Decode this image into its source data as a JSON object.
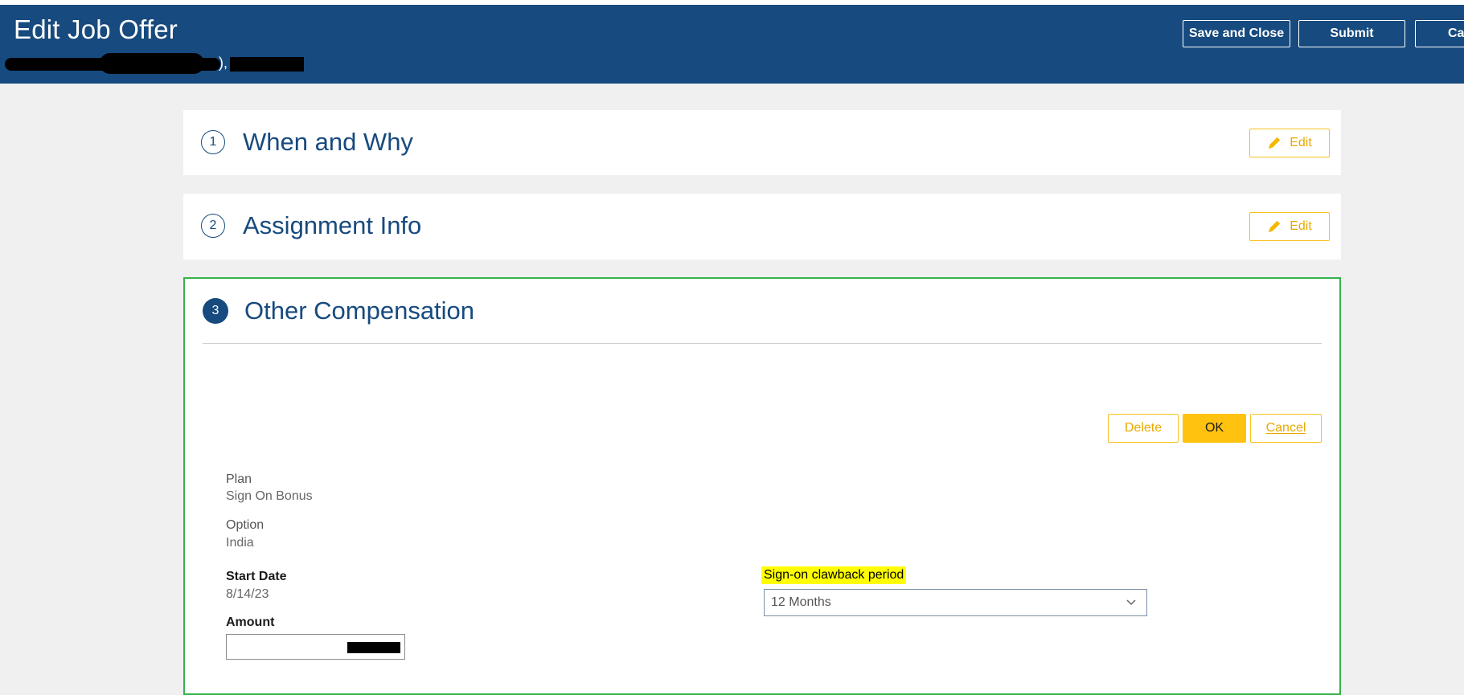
{
  "header": {
    "title": "Edit Job Offer",
    "subtitle_suffix": "),",
    "buttons": {
      "save_and_close": "Save and Close",
      "submit": "Submit",
      "cancel_partial": "Ca"
    }
  },
  "sections": [
    {
      "number": "1",
      "title": "When and Why",
      "edit_label": "Edit"
    },
    {
      "number": "2",
      "title": "Assignment Info",
      "edit_label": "Edit"
    },
    {
      "number": "3",
      "title": "Other Compensation"
    }
  ],
  "compensation": {
    "actions": {
      "delete": "Delete",
      "ok": "OK",
      "cancel": "Cancel"
    },
    "plan_label": "Plan",
    "plan_value": "Sign On Bonus",
    "option_label": "Option",
    "option_value": "India",
    "start_date_label": "Start Date",
    "start_date_value": "8/14/23",
    "amount_label": "Amount",
    "clawback_label": "Sign-on clawback period",
    "clawback_value": "12 Months"
  },
  "colors": {
    "header_bg": "#174a7e",
    "accent_yellow": "#ffc20e",
    "active_border": "#35b24a",
    "highlight": "#ffff00"
  }
}
